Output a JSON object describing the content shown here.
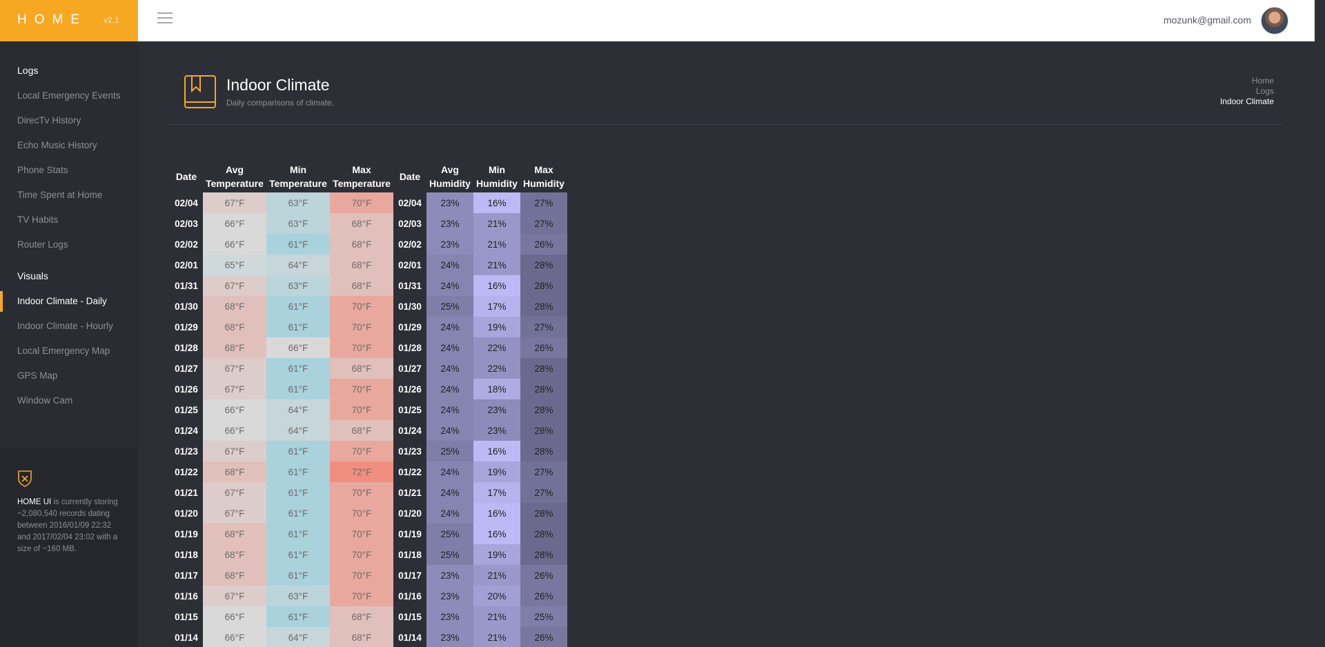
{
  "brand": {
    "title": "HOME",
    "version": "v2.1"
  },
  "user": {
    "email": "mozunk@gmail.com"
  },
  "sidebar": {
    "sections": [
      {
        "title": "Logs",
        "items": [
          "Local Emergency Events",
          "DirecTv History",
          "Echo Music History",
          "Phone Stats",
          "Time Spent at Home",
          "TV Habits",
          "Router Logs"
        ]
      },
      {
        "title": "Visuals",
        "items": [
          "Indoor Climate - Daily",
          "Indoor Climate - Hourly",
          "Local Emergency Map",
          "GPS Map",
          "Window Cam"
        ]
      }
    ],
    "active_item": "Indoor Climate - Daily",
    "footer": {
      "strong": "HOME UI",
      "text": " is currently storing ~2,080,540 records dating between 2016/01/09 22:32 and 2017/02/04 23:02 with a size of ~160 MB."
    }
  },
  "page": {
    "title": "Indoor Climate",
    "subtitle": "Daily comparisons of climate.",
    "breadcrumbs": [
      "Home",
      "Logs",
      "Indoor Climate"
    ]
  },
  "colors": {
    "accent": "#f7a823",
    "temp_cold": "#a9d2dd",
    "temp_neutral": "#d9d9d9",
    "temp_warm": "#f08f80",
    "hum_low": "#bcb9f5",
    "hum_high": "#6b6a8e"
  },
  "table": {
    "headers": [
      "Date",
      "Avg\nTemperature",
      "Min\nTemperature",
      "Max\nTemperature",
      "Date",
      "Avg\nHumidity",
      "Min\nHumidity",
      "Max\nHumidity"
    ],
    "rows": [
      [
        "02/04",
        "67°F",
        "63°F",
        "70°F",
        "23%",
        "16%",
        "27%"
      ],
      [
        "02/03",
        "66°F",
        "63°F",
        "68°F",
        "23%",
        "21%",
        "27%"
      ],
      [
        "02/02",
        "66°F",
        "61°F",
        "68°F",
        "23%",
        "21%",
        "26%"
      ],
      [
        "02/01",
        "65°F",
        "64°F",
        "68°F",
        "24%",
        "21%",
        "28%"
      ],
      [
        "01/31",
        "67°F",
        "63°F",
        "68°F",
        "24%",
        "16%",
        "28%"
      ],
      [
        "01/30",
        "68°F",
        "61°F",
        "70°F",
        "25%",
        "17%",
        "28%"
      ],
      [
        "01/29",
        "68°F",
        "61°F",
        "70°F",
        "24%",
        "19%",
        "27%"
      ],
      [
        "01/28",
        "68°F",
        "66°F",
        "70°F",
        "24%",
        "22%",
        "26%"
      ],
      [
        "01/27",
        "67°F",
        "61°F",
        "68°F",
        "24%",
        "22%",
        "28%"
      ],
      [
        "01/26",
        "67°F",
        "61°F",
        "70°F",
        "24%",
        "18%",
        "28%"
      ],
      [
        "01/25",
        "66°F",
        "64°F",
        "70°F",
        "24%",
        "23%",
        "28%"
      ],
      [
        "01/24",
        "66°F",
        "64°F",
        "68°F",
        "24%",
        "23%",
        "28%"
      ],
      [
        "01/23",
        "67°F",
        "61°F",
        "70°F",
        "25%",
        "16%",
        "28%"
      ],
      [
        "01/22",
        "68°F",
        "61°F",
        "72°F",
        "24%",
        "19%",
        "27%"
      ],
      [
        "01/21",
        "67°F",
        "61°F",
        "70°F",
        "24%",
        "17%",
        "27%"
      ],
      [
        "01/20",
        "67°F",
        "61°F",
        "70°F",
        "24%",
        "16%",
        "28%"
      ],
      [
        "01/19",
        "68°F",
        "61°F",
        "70°F",
        "25%",
        "16%",
        "28%"
      ],
      [
        "01/18",
        "68°F",
        "61°F",
        "70°F",
        "25%",
        "19%",
        "28%"
      ],
      [
        "01/17",
        "68°F",
        "61°F",
        "70°F",
        "23%",
        "21%",
        "26%"
      ],
      [
        "01/16",
        "67°F",
        "63°F",
        "70°F",
        "23%",
        "20%",
        "26%"
      ],
      [
        "01/15",
        "66°F",
        "61°F",
        "68°F",
        "23%",
        "21%",
        "25%"
      ],
      [
        "01/14",
        "66°F",
        "64°F",
        "68°F",
        "23%",
        "21%",
        "26%"
      ]
    ]
  }
}
